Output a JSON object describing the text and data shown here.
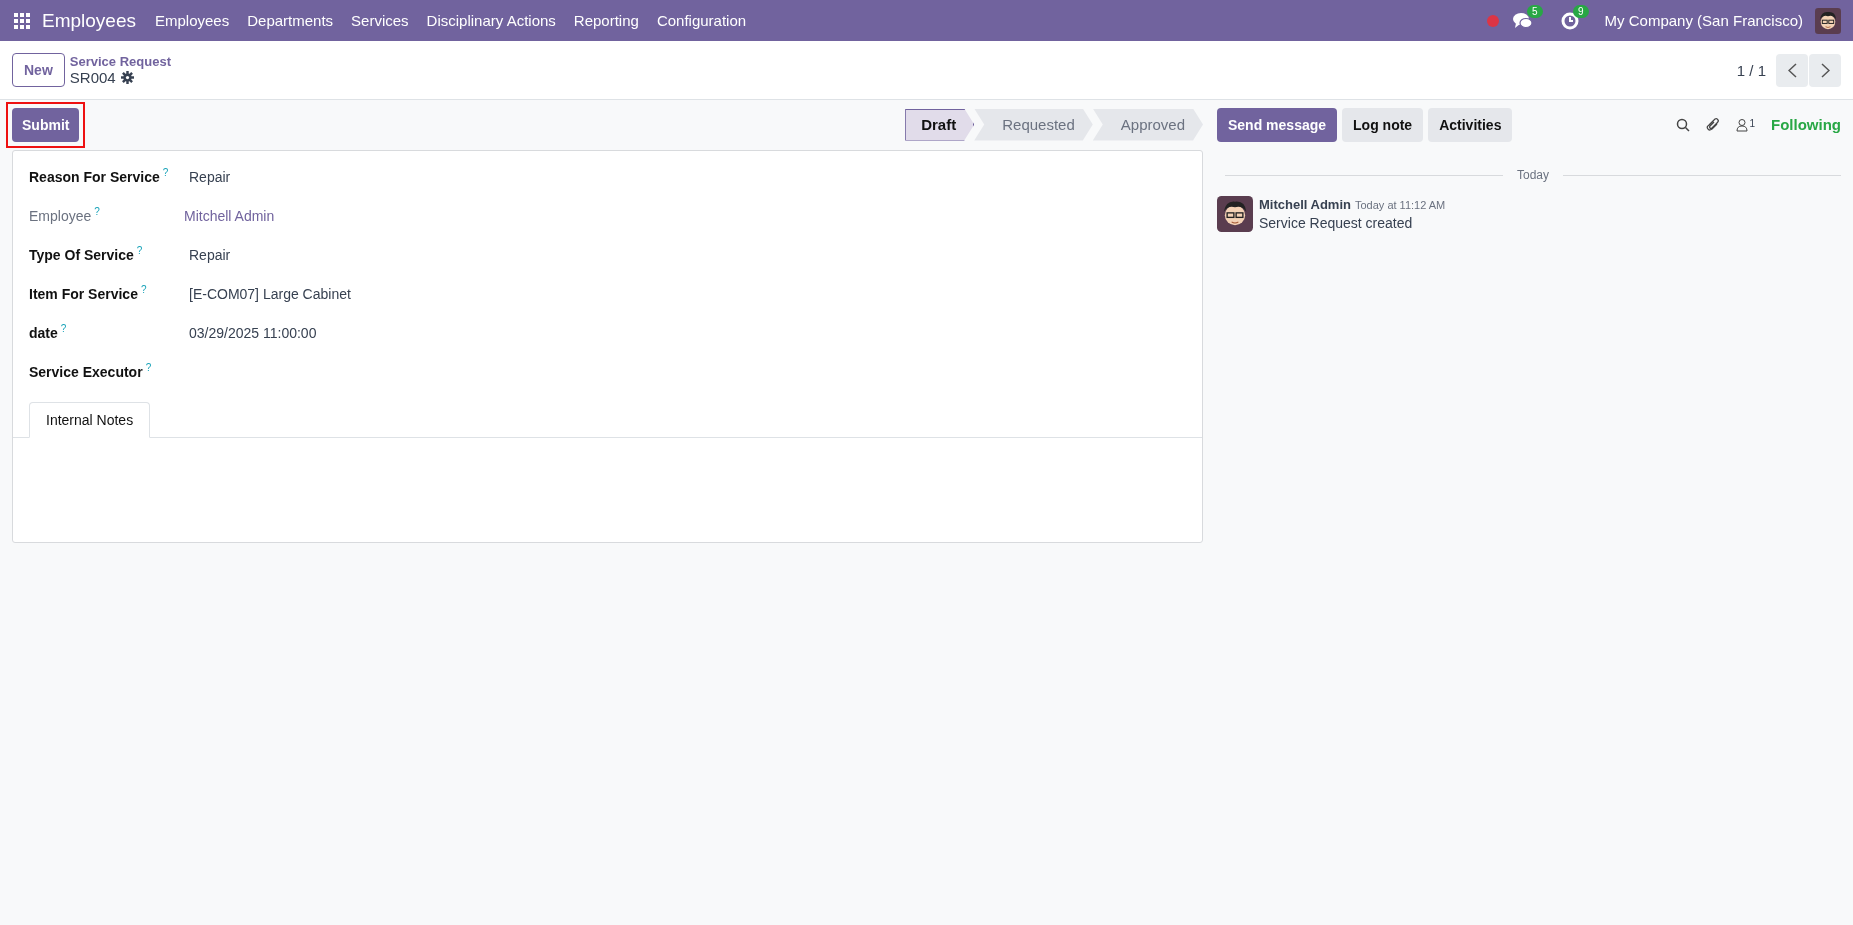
{
  "navbar": {
    "app_name": "Employees",
    "menu": [
      "Employees",
      "Departments",
      "Services",
      "Disciplinary Actions",
      "Reporting",
      "Configuration"
    ],
    "messages_count": "5",
    "activities_count": "9",
    "company": "My Company (San Francisco)"
  },
  "control_panel": {
    "new_button": "New",
    "breadcrumb": "Service Request",
    "record_name": "SR004",
    "pager": "1 / 1"
  },
  "action_buttons": [
    {
      "label": "Submit",
      "highlighted": true
    }
  ],
  "statusbar": [
    {
      "label": "Draft",
      "selected": true
    },
    {
      "label": "Requested",
      "selected": false
    },
    {
      "label": "Approved",
      "selected": false
    }
  ],
  "fields": [
    {
      "label": "Reason For Service",
      "value": "Repair",
      "readonly": false,
      "kind": "text"
    },
    {
      "label": "Employee",
      "value": "Mitchell Admin",
      "readonly": true,
      "kind": "link"
    },
    {
      "label": "Type Of Service",
      "value": "Repair",
      "readonly": false,
      "kind": "text"
    },
    {
      "label": "Item For Service",
      "value": "[E-COM07] Large Cabinet",
      "readonly": false,
      "kind": "text"
    },
    {
      "label": "date",
      "value": "03/29/2025 11:00:00",
      "readonly": false,
      "kind": "text"
    },
    {
      "label": "Service Executor",
      "readonly": false
    }
  ],
  "help_mark": "?",
  "notebook_tabs": [
    {
      "label": "Internal Notes",
      "selected": true
    }
  ],
  "chatter": {
    "buttons": [
      {
        "label": "Send message",
        "kind": "primary"
      },
      {
        "label": "Log note",
        "kind": "secondary"
      },
      {
        "label": "Activities",
        "kind": "secondary"
      }
    ],
    "followers_count": "1",
    "follow_label": "Following",
    "date_separator": "Today",
    "messages": [
      {
        "author": "Mitchell Admin",
        "time": "Today at 11:12 AM",
        "body": "Service Request created"
      }
    ]
  }
}
